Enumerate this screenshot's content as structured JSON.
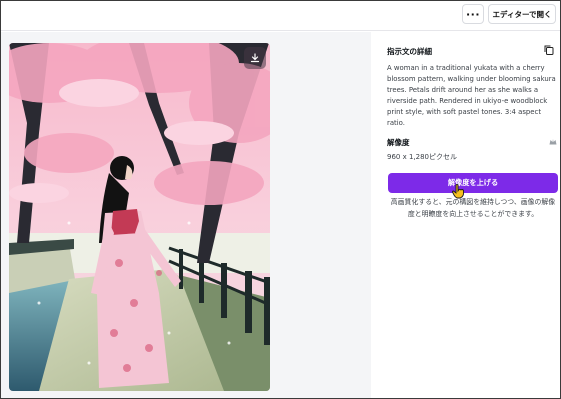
{
  "header": {
    "more_label": "···",
    "open_editor_label": "エディターで開く"
  },
  "prompt_section": {
    "title": "指示文の詳細",
    "text": "A woman in a traditional yukata with a cherry blossom pattern, walking under blooming sakura trees. Petals drift around her as she walks a riverside path. Rendered in ukiyo-e woodblock print style, with soft pastel tones. 3:4 aspect ratio."
  },
  "resolution_section": {
    "title": "解像度",
    "value": "960 x 1,280ピクセル"
  },
  "upscale_button_label": "解像度を上げる",
  "helper_text": "高画質化すると、元の構図を維持しつつ、画像の解像度と明瞭度を向上させることができます。",
  "icons": [
    "more-icon",
    "download-icon",
    "copy-icon",
    "crown-icon",
    "hand-pointer-icon"
  ],
  "colors": {
    "accent": "#7d2ae8",
    "left_pane_bg": "#f4f5f7"
  }
}
